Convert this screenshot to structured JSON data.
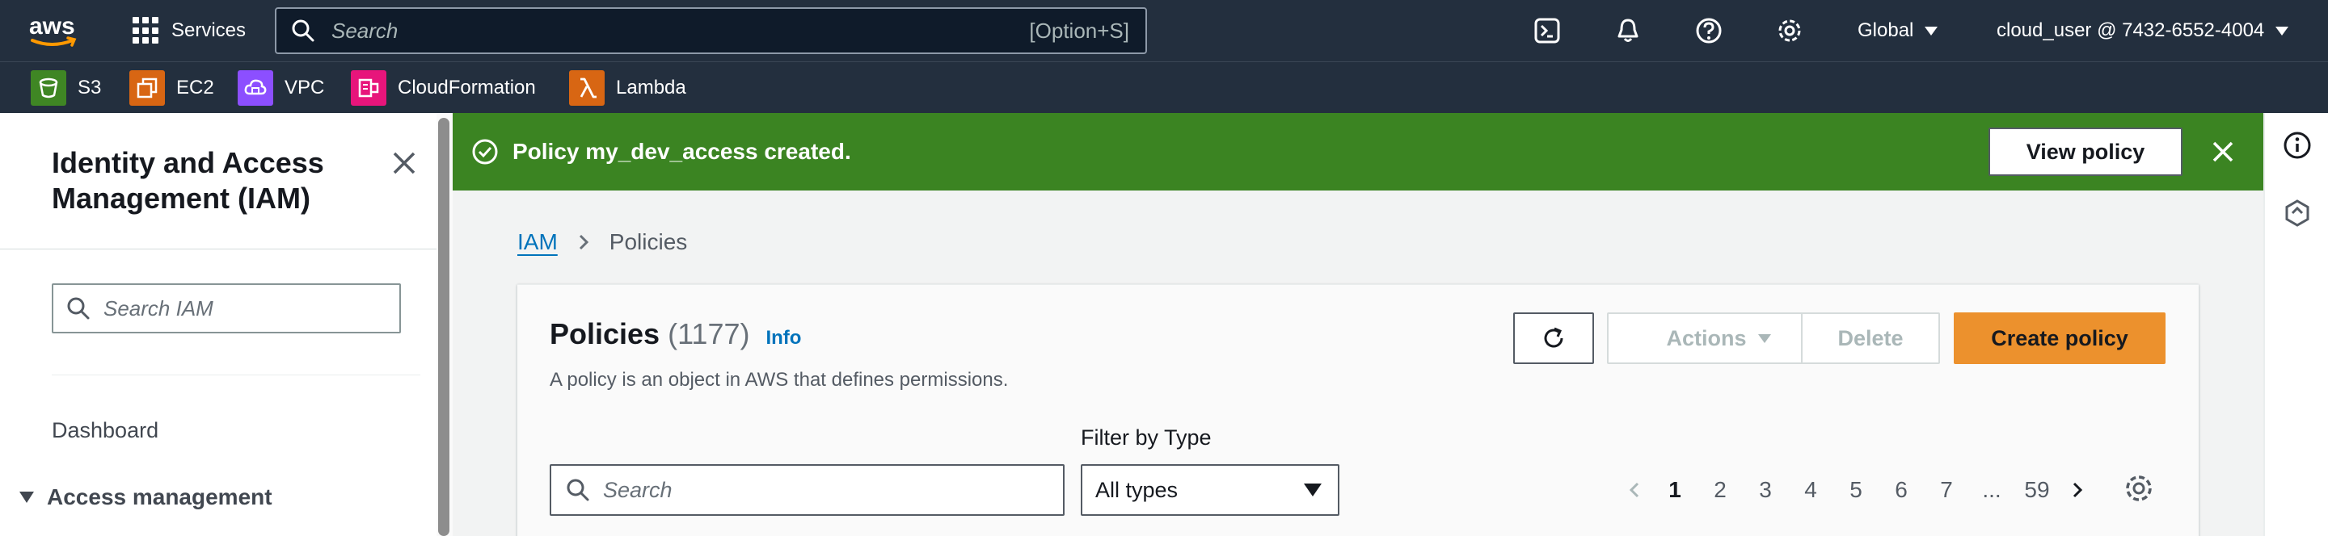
{
  "topnav": {
    "logo_text": "aws",
    "services_label": "Services",
    "search_placeholder": "Search",
    "search_shortcut": "[Option+S]",
    "icons": [
      "cloudshell-icon",
      "notifications-icon",
      "help-icon",
      "settings-icon"
    ],
    "region": "Global",
    "account": "cloud_user @ 7432-6552-4004"
  },
  "favorites": [
    {
      "label": "S3",
      "color": "#3f8624",
      "icon": "s3-icon"
    },
    {
      "label": "EC2",
      "color": "#d86613",
      "icon": "ec2-icon"
    },
    {
      "label": "VPC",
      "color": "#8c4fff",
      "icon": "vpc-icon"
    },
    {
      "label": "CloudFormation",
      "color": "#e7157b",
      "icon": "cloudformation-icon"
    },
    {
      "label": "Lambda",
      "color": "#d86613",
      "icon": "lambda-icon"
    }
  ],
  "sidebar": {
    "title": "Identity and Access Management (IAM)",
    "search_placeholder": "Search IAM",
    "items": [
      {
        "label": "Dashboard"
      },
      {
        "label": "Access management"
      }
    ]
  },
  "flash": {
    "message": "Policy my_dev_access created.",
    "button": "View policy",
    "color": "#3b8422"
  },
  "breadcrumb": {
    "root": "IAM",
    "current": "Policies"
  },
  "panel": {
    "title": "Policies",
    "count": "(1177)",
    "info": "Info",
    "description": "A policy is an object in AWS that defines permissions.",
    "actions_label": "Actions",
    "delete_label": "Delete",
    "create_label": "Create policy",
    "accent": "#ec912d",
    "search_placeholder": "Search",
    "filter_label": "Filter by Type",
    "filter_value": "All types",
    "pages": [
      "1",
      "2",
      "3",
      "4",
      "5",
      "6",
      "7",
      "...",
      "59"
    ],
    "current_page": "1"
  }
}
